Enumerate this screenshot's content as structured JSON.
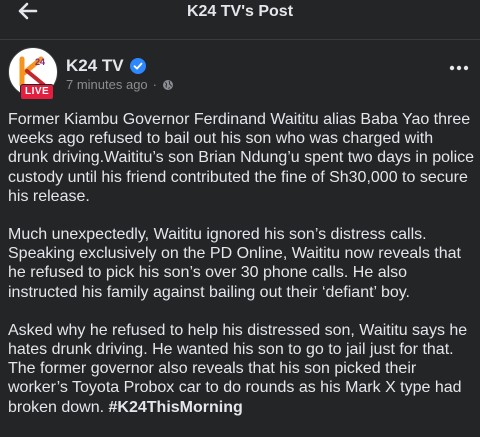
{
  "topbar": {
    "title": "K24 TV's Post",
    "back_icon": "arrow-left-icon"
  },
  "post": {
    "author": "K24 TV",
    "verified": true,
    "time": "7 minutes ago",
    "audience_icon": "globe-icon",
    "live_badge": "LIVE",
    "avatar_text": "24",
    "more_icon": "ellipsis-icon",
    "paragraphs": [
      "Former Kiambu Governor Ferdinand Waititu alias Baba Yao three weeks ago refused to bail out his son who was charged with drunk driving.Waititu’s son Brian Ndung’u spent two days in police custody until his friend contributed the fine of Sh30,000 to secure his release.",
      "Much unexpectedly, Waititu ignored his son’s distress calls. Speaking exclusively on the PD Online, Waititu now reveals that he refused to pick his son’s over 30 phone calls. He also instructed his family against bailing out their ‘defiant’ boy.",
      "Asked why he refused to help his distressed son, Waititu says he hates drunk driving. He wanted his son to go to jail just for that. The former governor also reveals that his son picked their worker’s Toyota Probox car to do rounds as his Mark X type had broken down."
    ],
    "hashtag": "#K24ThisMorning"
  },
  "colors": {
    "background": "#242526",
    "text": "#e4e6eb",
    "secondary_text": "#8a8d91",
    "verified_blue": "#2d88ff",
    "live_red": "#e41e3f",
    "brand_orange": "#f7941d"
  }
}
